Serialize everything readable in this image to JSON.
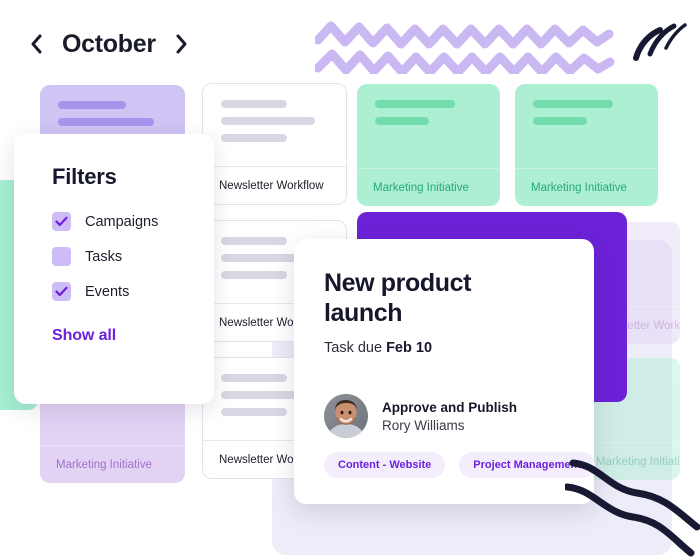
{
  "header": {
    "prev_icon": "chevron-left-icon",
    "month": "October",
    "next_icon": "chevron-right-icon"
  },
  "filters": {
    "title": "Filters",
    "options": [
      {
        "label": "Campaigns",
        "checked": true
      },
      {
        "label": "Tasks",
        "checked": false
      },
      {
        "label": "Events",
        "checked": true
      }
    ],
    "show_all": "Show all"
  },
  "detail_card": {
    "title": "New product launch",
    "due_prefix": "Task due ",
    "due_date": "Feb 10",
    "assignee": {
      "task": "Approve and Publish",
      "name": "Rory Williams",
      "avatar": "user-avatar"
    },
    "tags": [
      "Content - Website",
      "Project Management"
    ]
  },
  "board": {
    "labels": {
      "newsletter": "Newsletter Workflow",
      "marketing": "Marketing Initiative"
    },
    "cards": [
      {
        "id": "lilac-top",
        "label": ""
      },
      {
        "id": "white-1",
        "label": "Newsletter Workflow"
      },
      {
        "id": "white-2",
        "label": "Newsletter Workflow"
      },
      {
        "id": "white-3",
        "label": "Newsletter Workflow"
      },
      {
        "id": "mint-1",
        "label": "Marketing Initiative"
      },
      {
        "id": "mint-2",
        "label": "Marketing Initiative"
      },
      {
        "id": "lilac-bottom",
        "label": "Marketing Initiative"
      },
      {
        "id": "faded-lilac",
        "label": "Newsletter Workflow"
      },
      {
        "id": "faded-mint",
        "label": "Marketing Initiative"
      }
    ]
  },
  "colors": {
    "accent_purple": "#6D20DE",
    "deep_purple": "#6C22D6",
    "mint": "#ACEFD2",
    "mint_text": "#27A97A",
    "lilac": "#CFC4F4",
    "lilac_soft": "#E2D2F4",
    "lavender_panel": "#EDECF8",
    "ink": "#16172B",
    "squiggle": "#C9B8F2",
    "stroke_dark": "#181A33"
  }
}
